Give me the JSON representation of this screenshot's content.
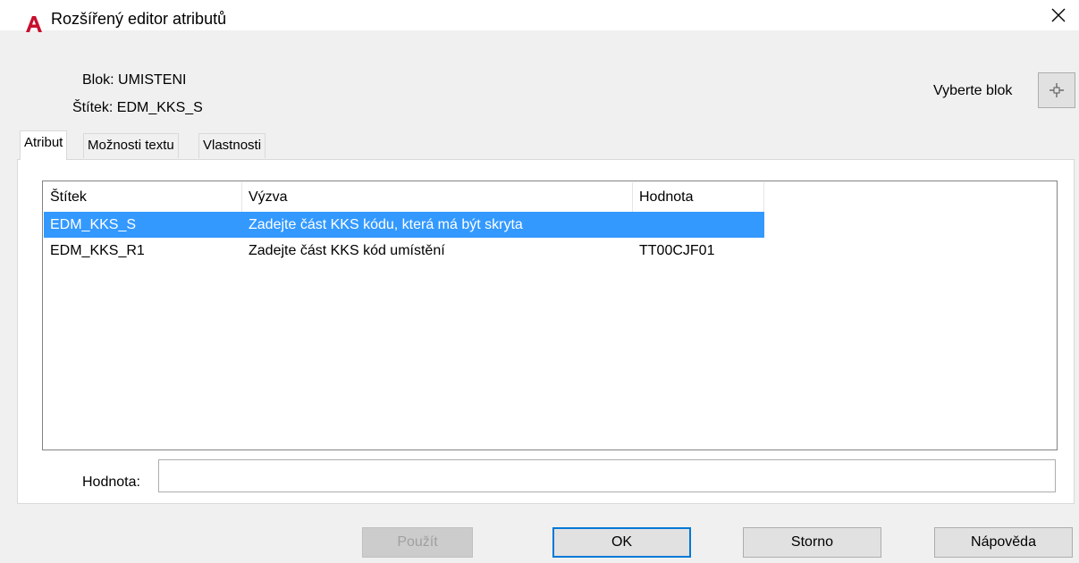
{
  "window": {
    "title": "Rozšířený editor atributů",
    "app_icon": "autocad-a-icon",
    "close_icon": "close-icon"
  },
  "info": {
    "block_label": "Blok: UMISTENI",
    "tag_label": "Štítek: EDM_KKS_S",
    "select_block_label": "Vyberte blok",
    "select_block_icon": "crosshair-pick-icon"
  },
  "tabs": [
    {
      "label": "Atribut",
      "active": true
    },
    {
      "label": "Možnosti textu",
      "active": false
    },
    {
      "label": "Vlastnosti",
      "active": false
    }
  ],
  "attribute_list": {
    "columns": [
      "Štítek",
      "Výzva",
      "Hodnota"
    ],
    "rows": [
      {
        "tag": "EDM_KKS_S",
        "prompt": "Zadejte část KKS kódu, která má být skryta",
        "value": "",
        "selected": true
      },
      {
        "tag": "EDM_KKS_R1",
        "prompt": "Zadejte část KKS kód umístění",
        "value": "TT00CJF01",
        "selected": false
      }
    ],
    "selection_color": "#3399ff"
  },
  "value_field": {
    "label": "Hodnota:",
    "value": ""
  },
  "buttons": {
    "apply": "Použít",
    "ok": "OK",
    "cancel": "Storno",
    "help": "Nápověda"
  },
  "colors": {
    "accent": "#0078d7",
    "app_icon_red": "#c8102e"
  }
}
